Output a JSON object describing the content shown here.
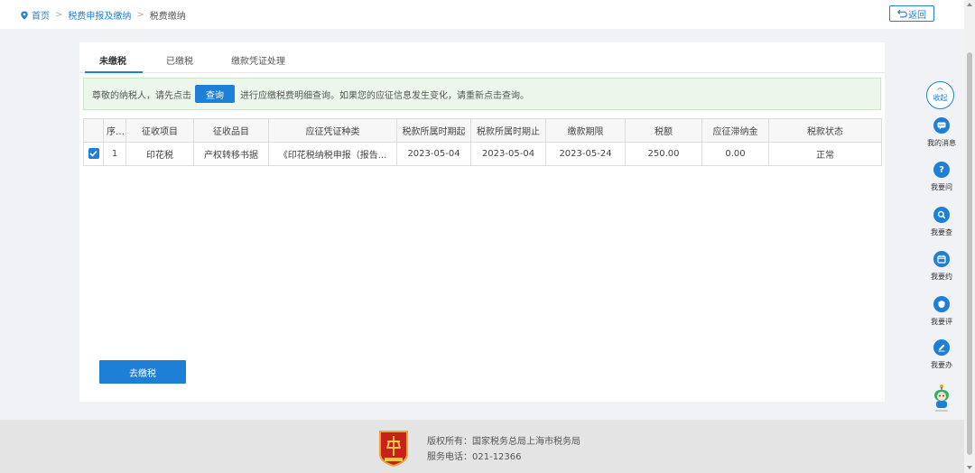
{
  "breadcrumb": {
    "home": "首页",
    "level1": "税费申报及缴纳",
    "current": "税费缴纳"
  },
  "back_button": "返回",
  "tabs": [
    "未缴税",
    "已缴税",
    "缴款凭证处理"
  ],
  "active_tab": 0,
  "notice": {
    "prefix": "尊敬的纳税人，请先点击",
    "button": "查询",
    "suffix": "进行应缴税费明细查询。如果您的应征信息发生变化，请重新点击查询。"
  },
  "table": {
    "headers": [
      "",
      "序号",
      "征收项目",
      "征收品目",
      "应征凭证种类",
      "税款所属时期起",
      "税款所属时期止",
      "缴款期限",
      "税额",
      "应征滞纳金",
      "税款状态"
    ],
    "rows": [
      {
        "checked": true,
        "cells": [
          "1",
          "印花税",
          "产权转移书据",
          "《印花税纳税申报（报告...",
          "2023-05-04",
          "2023-05-04",
          "2023-05-24",
          "250.00",
          "0.00",
          "正常"
        ]
      }
    ]
  },
  "pay_button": "去缴税",
  "footer": {
    "copyright": "版权所有：国家税务总局上海市税务局",
    "phone": "服务电话：021-12366"
  },
  "right_sidebar": {
    "collapse": "收起",
    "items": [
      {
        "label": "我的消息",
        "icon": "message-icon"
      },
      {
        "label": "我要问",
        "icon": "question-icon"
      },
      {
        "label": "我要查",
        "icon": "search-icon"
      },
      {
        "label": "我要约",
        "icon": "calendar-icon"
      },
      {
        "label": "我要评",
        "icon": "rate-icon"
      },
      {
        "label": "我要办",
        "icon": "edit-icon"
      }
    ]
  },
  "colors": {
    "primary": "#1e7fd6",
    "notice_bg": "#eaf7ea",
    "footer_bg": "#e4e4e4"
  }
}
